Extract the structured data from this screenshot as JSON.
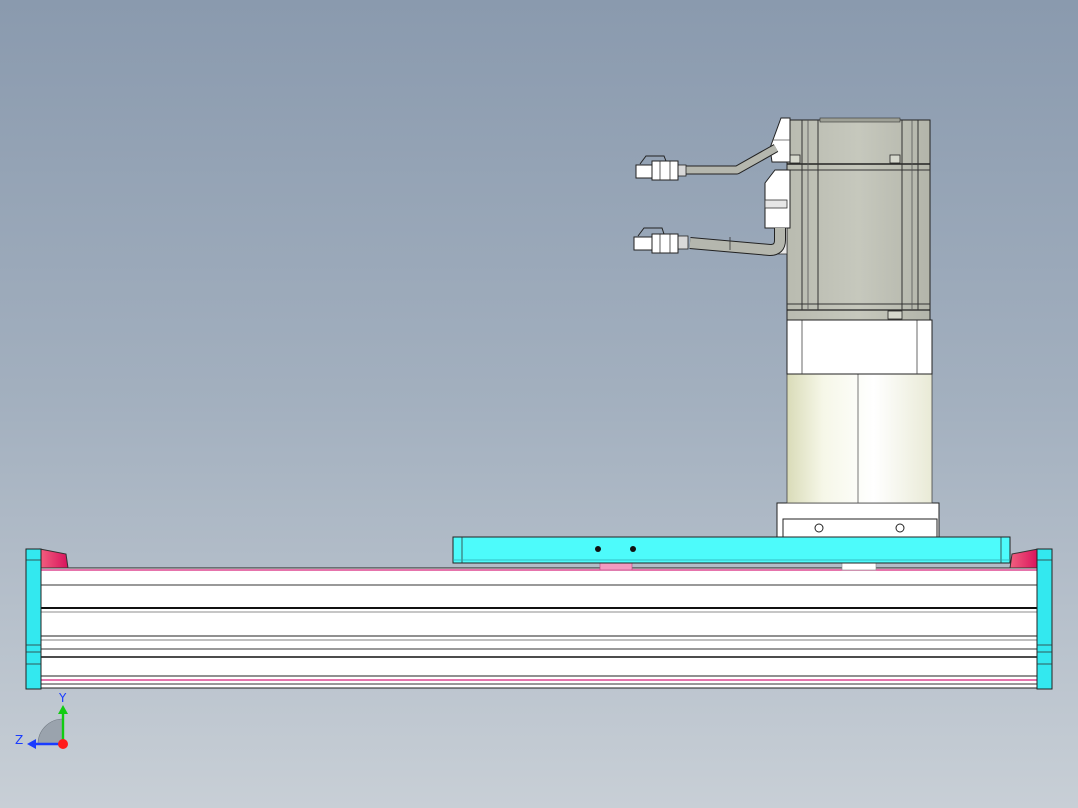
{
  "viewport": {
    "background_top": "#8a9aae",
    "background_bottom": "#c8cfd6"
  },
  "colors": {
    "carriage": "#4dfbfb",
    "end_cap": "#33e8ef",
    "end_stop": "#e8206a",
    "rail_body": "#ffffff",
    "rail_edge": "#111111",
    "motor_body": "#bfc1b6",
    "gearbox": "#f2f3e2",
    "flange": "#ffffff"
  },
  "triad": {
    "y_label": "Y",
    "z_label": "Z",
    "x_axis_color": "#ff1a1a",
    "y_axis_color": "#11cc11",
    "z_axis_color": "#1a3cff"
  }
}
